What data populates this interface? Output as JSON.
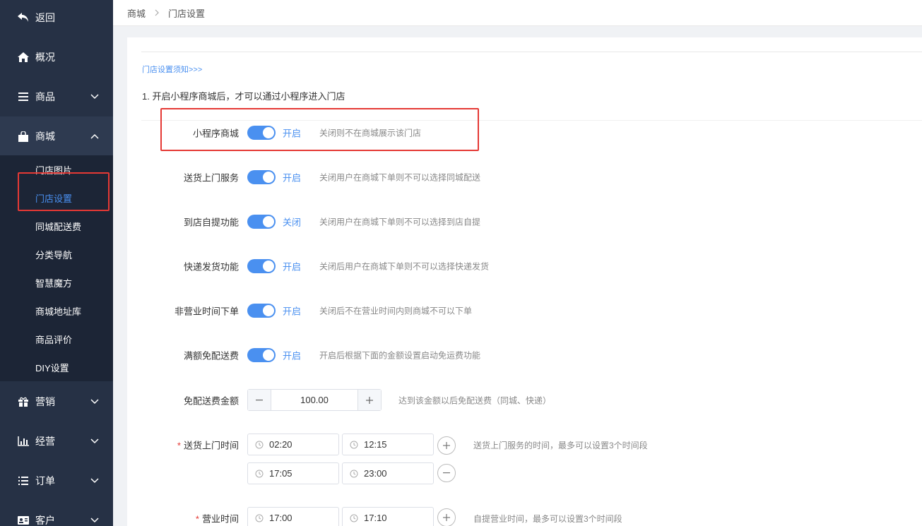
{
  "sidebar": {
    "back": {
      "label": "返回",
      "icon": "back-arrow-icon"
    },
    "items": [
      {
        "label": "概况",
        "icon": "home-icon"
      },
      {
        "label": "商品",
        "icon": "list-icon"
      },
      {
        "label": "商城",
        "icon": "shopping-bag-icon"
      },
      {
        "label": "营销",
        "icon": "gift-icon"
      },
      {
        "label": "经营",
        "icon": "bar-chart-icon"
      },
      {
        "label": "订单",
        "icon": "order-list-icon"
      },
      {
        "label": "客户",
        "icon": "customer-card-icon"
      }
    ],
    "submenu": [
      {
        "label": "门店图片"
      },
      {
        "label": "门店设置"
      },
      {
        "label": "同城配送费"
      },
      {
        "label": "分类导航"
      },
      {
        "label": "智慧魔方"
      },
      {
        "label": "商城地址库"
      },
      {
        "label": "商品评价"
      },
      {
        "label": "DIY设置"
      }
    ]
  },
  "breadcrumb": {
    "parent": "商城",
    "current": "门店设置"
  },
  "main": {
    "notice_link": "门店设置须知>>>",
    "tip": "1. 开启小程序商城后，才可以通过小程序进入门店",
    "settings": [
      {
        "label": "小程序商城",
        "state": "开启",
        "hint": "关闭则不在商城展示该门店"
      },
      {
        "label": "送货上门服务",
        "state": "开启",
        "hint": "关闭用户在商城下单则不可以选择同城配送"
      },
      {
        "label": "到店自提功能",
        "state": "关闭",
        "hint": "关闭用户在商城下单则不可以选择到店自提"
      },
      {
        "label": "快递发货功能",
        "state": "开启",
        "hint": "关闭后用户在商城下单则不可以选择快递发货"
      },
      {
        "label": "非营业时间下单",
        "state": "开启",
        "hint": "关闭后不在营业时间内则商城不可以下单"
      },
      {
        "label": "满额免配送费",
        "state": "开启",
        "hint": "开启后根据下面的金额设置启动免运费功能"
      }
    ],
    "free_amount": {
      "label": "免配送费金额",
      "value": "100.00",
      "hint": "达到该金额以后免配送费（同城、快递）"
    },
    "delivery_time": {
      "label": "送货上门时间",
      "required": "*",
      "slots": [
        [
          "02:20",
          "12:15"
        ],
        [
          "17:05",
          "23:00"
        ]
      ],
      "hint": "送货上门服务的时间，最多可以设置3个时间段"
    },
    "business_time": {
      "label": "营业时间",
      "required": "*",
      "slots": [
        [
          "17:00",
          "17:10"
        ]
      ],
      "hint": "自提营业时间，最多可以设置3个时间段"
    }
  }
}
